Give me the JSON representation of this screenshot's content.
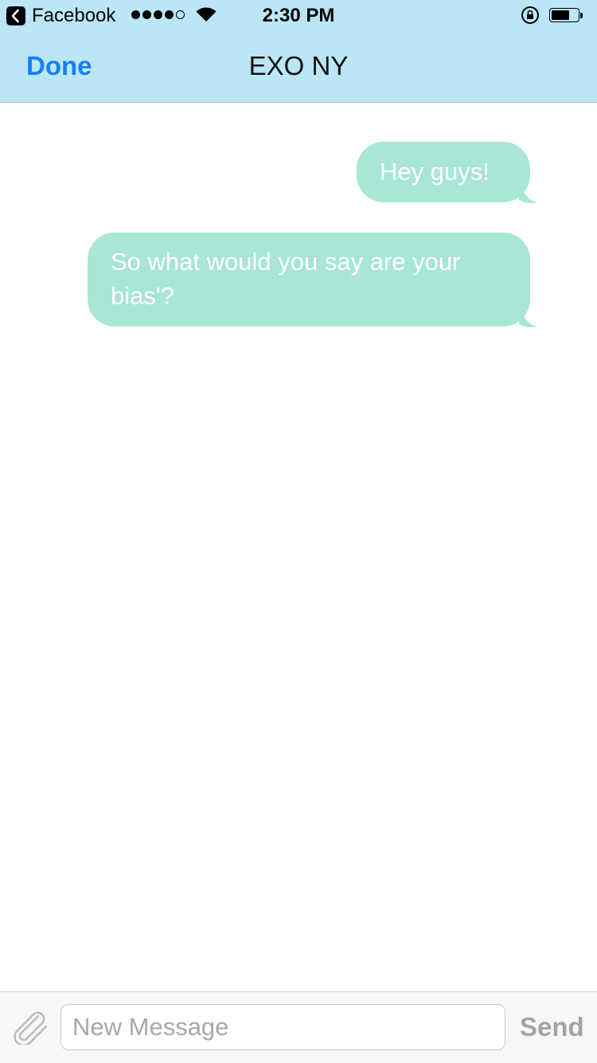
{
  "status_bar": {
    "back_app": "Facebook",
    "signal_bars_filled": 4,
    "signal_bars_total": 5,
    "time": "2:30 PM",
    "battery_level": 0.7,
    "icons": [
      "back-chevron-icon",
      "wifi-icon",
      "rotation-lock-icon",
      "battery-icon"
    ]
  },
  "nav": {
    "done_label": "Done",
    "title": "EXO NY"
  },
  "messages": [
    {
      "text": "Hey guys!",
      "direction": "outgoing"
    },
    {
      "text": "So what would you say are your bias'?",
      "direction": "outgoing"
    }
  ],
  "composer": {
    "placeholder": "New Message",
    "value": "",
    "send_label": "Send",
    "attach_icon": "paperclip-icon"
  },
  "colors": {
    "header_bg": "#bae6f6",
    "accent": "#1a7ff5",
    "bubble_bg": "#a8e6d5",
    "bubble_text": "#ffffff",
    "send_disabled": "#a4a4a4"
  }
}
